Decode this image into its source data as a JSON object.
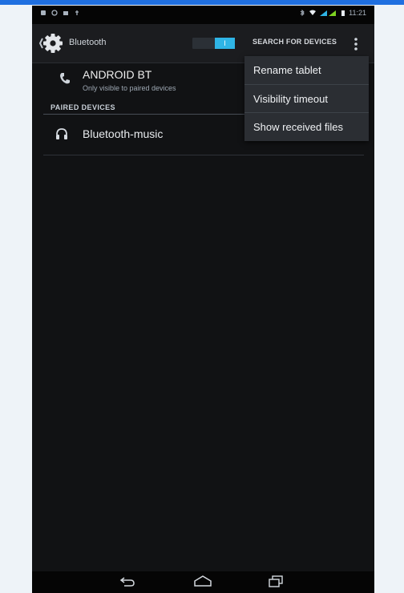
{
  "status_bar": {
    "time": "11:21",
    "left_icons": [
      "notification-icon",
      "sync-icon",
      "gallery-icon",
      "usb-icon"
    ],
    "right_icons": [
      "bluetooth-icon",
      "wifi-icon",
      "signal-icon",
      "battery-icon"
    ]
  },
  "action_bar": {
    "title": "Bluetooth",
    "toggle_state": "I",
    "search_label": "SEARCH FOR DEVICES",
    "overflow_icon": "overflow-menu-icon"
  },
  "device": {
    "name": "ANDROID BT",
    "subtitle": "Only visible to paired devices"
  },
  "paired_devices": {
    "header": "PAIRED DEVICES",
    "items": [
      {
        "name": "Bluetooth-music",
        "icon": "headphone-icon"
      }
    ]
  },
  "overflow_menu": {
    "items": [
      {
        "label": "Rename tablet"
      },
      {
        "label": "Visibility timeout"
      },
      {
        "label": "Show received files"
      }
    ]
  },
  "nav_bar": {
    "buttons": [
      "back-icon",
      "home-icon",
      "recent-apps-icon"
    ]
  },
  "colors": {
    "accent": "#2fb5e6",
    "screen_background": "#111214",
    "page_background": "#eef3f8",
    "menu_background": "#2b2e33"
  }
}
